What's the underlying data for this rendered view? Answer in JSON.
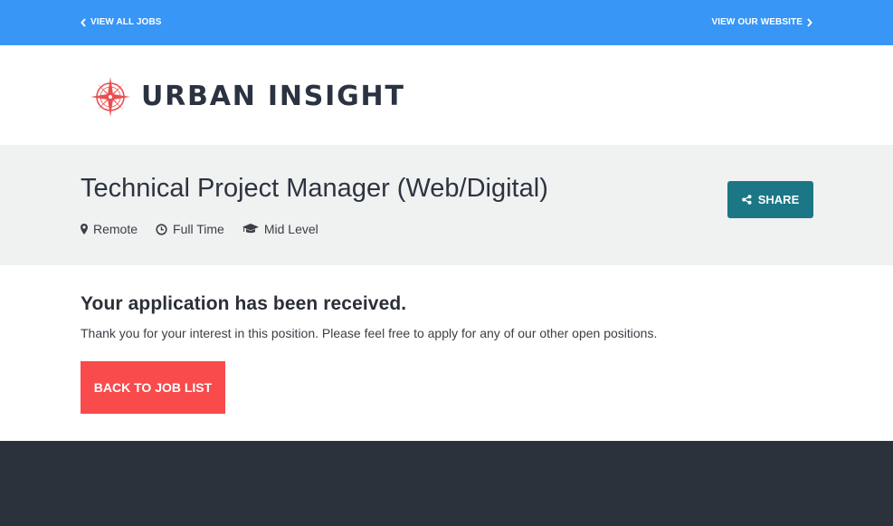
{
  "topbar": {
    "view_all_jobs": "VIEW ALL JOBS",
    "view_website": "VIEW OUR WEBSITE",
    "background": "#3796f6"
  },
  "brand": {
    "name": "URBAN INSIGHT",
    "icon": "compass-rose-icon",
    "accent": "#e85050"
  },
  "job": {
    "title": "Technical Project Manager (Web/Digital)",
    "location": "Remote",
    "type": "Full Time",
    "level": "Mid Level",
    "share_label": "SHARE",
    "share_color": "#1b7786"
  },
  "confirmation": {
    "heading": "Your application has been received.",
    "message": "Thank you for your interest in this position. Please feel free to apply for any of our other open positions.",
    "back_label": "BACK TO JOB LIST",
    "button_color": "#f94a4c"
  },
  "footer": {
    "background": "#2b323c"
  }
}
